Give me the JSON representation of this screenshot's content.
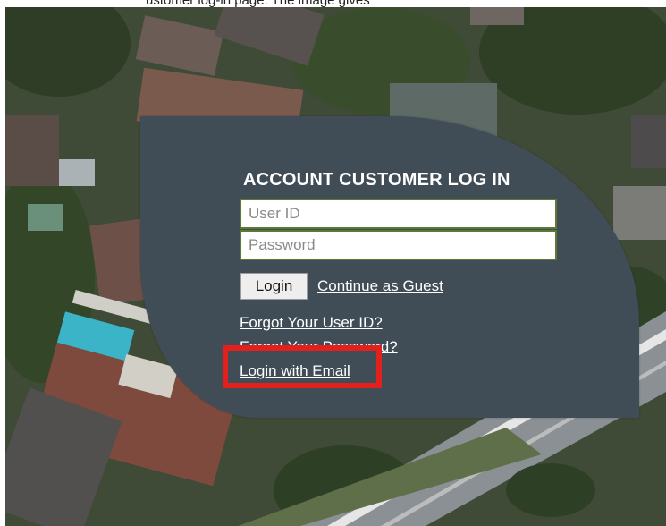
{
  "page": {
    "partial_heading": "ustomer log-in page. The image gives"
  },
  "login_form": {
    "title": "ACCOUNT CUSTOMER LOG IN",
    "user_id_placeholder": "User ID",
    "user_id_value": "",
    "password_placeholder": "Password",
    "password_value": "",
    "login_button_label": "Login",
    "guest_link": "Continue as Guest",
    "forgot_user_id_link": "Forgot Your User ID?",
    "forgot_password_link": "Forgot Your Password?",
    "email_login_link": "Login with Email"
  },
  "highlight": {
    "target": "email_login_link",
    "color": "#e3201b"
  },
  "colors": {
    "panel": "#404c56",
    "input_border": "#5d7a35",
    "link": "#ffffff"
  }
}
